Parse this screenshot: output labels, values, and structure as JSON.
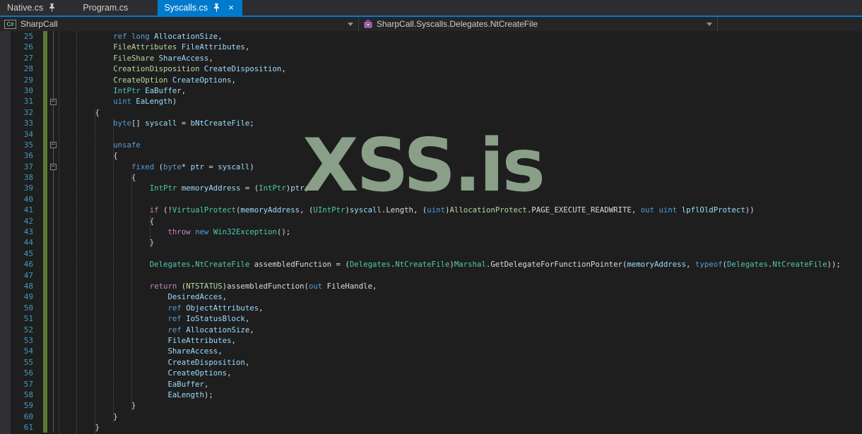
{
  "tabs": [
    {
      "label": "Native.cs",
      "pinned": true,
      "active": false
    },
    {
      "label": "Program.cs",
      "pinned": false,
      "active": false
    },
    {
      "label": "Syscalls.cs",
      "pinned": true,
      "active": true
    }
  ],
  "icons": {
    "close": "×",
    "fold_collapse": "−",
    "csharp_badge": "C#"
  },
  "navbar": {
    "project": "SharpCall",
    "member": "SharpCall.Syscalls.Delegates.NtCreateFile"
  },
  "watermark": {
    "text": "XSS.is",
    "color": "#93ab92"
  },
  "palette": {
    "accent": "#007acc",
    "editor_bg": "#1e1e1e",
    "tabstrip_bg": "#2d2d30",
    "navbar_bg": "#252526",
    "keyword": "#569cd6",
    "control_keyword": "#c586c0",
    "type": "#4ec9b0",
    "enum_type": "#b8d7a3",
    "identifier": "#9cdcfe",
    "plain_text": "#dcdcdc",
    "line_number": "#4399bd",
    "change_bar": "#5a7a32"
  },
  "editor": {
    "first_line": 25,
    "last_line": 61,
    "lines": [
      {
        "n": 25,
        "t": [
          [
            "i",
            "            "
          ],
          [
            "k",
            "ref"
          ],
          [
            "p",
            " "
          ],
          [
            "k",
            "long"
          ],
          [
            "p",
            " "
          ],
          [
            "v",
            "AllocationSize"
          ],
          [
            "p",
            ","
          ]
        ]
      },
      {
        "n": 26,
        "t": [
          [
            "i",
            "            "
          ],
          [
            "e",
            "FileAttributes"
          ],
          [
            "p",
            " "
          ],
          [
            "v",
            "FileAttributes"
          ],
          [
            "p",
            ","
          ]
        ]
      },
      {
        "n": 27,
        "t": [
          [
            "i",
            "            "
          ],
          [
            "e",
            "FileShare"
          ],
          [
            "p",
            " "
          ],
          [
            "v",
            "ShareAccess"
          ],
          [
            "p",
            ","
          ]
        ]
      },
      {
        "n": 28,
        "t": [
          [
            "i",
            "            "
          ],
          [
            "e",
            "CreationDisposition"
          ],
          [
            "p",
            " "
          ],
          [
            "v",
            "CreateDisposition"
          ],
          [
            "p",
            ","
          ]
        ]
      },
      {
        "n": 29,
        "t": [
          [
            "i",
            "            "
          ],
          [
            "e",
            "CreateOption"
          ],
          [
            "p",
            " "
          ],
          [
            "v",
            "CreateOptions"
          ],
          [
            "p",
            ","
          ]
        ]
      },
      {
        "n": 30,
        "t": [
          [
            "i",
            "            "
          ],
          [
            "t",
            "IntPtr"
          ],
          [
            "p",
            " "
          ],
          [
            "v",
            "EaBuffer"
          ],
          [
            "p",
            ","
          ]
        ]
      },
      {
        "n": 31,
        "fold": true,
        "t": [
          [
            "i",
            "            "
          ],
          [
            "k",
            "uint"
          ],
          [
            "p",
            " "
          ],
          [
            "v",
            "EaLength"
          ],
          [
            "p",
            ")"
          ]
        ]
      },
      {
        "n": 32,
        "t": [
          [
            "i",
            "        "
          ],
          [
            "p",
            "{"
          ]
        ]
      },
      {
        "n": 33,
        "t": [
          [
            "i",
            "            "
          ],
          [
            "k",
            "byte"
          ],
          [
            "p",
            "[] "
          ],
          [
            "v",
            "syscall"
          ],
          [
            "p",
            " = "
          ],
          [
            "v",
            "bNtCreateFile"
          ],
          [
            "p",
            ";"
          ]
        ]
      },
      {
        "n": 34,
        "t": []
      },
      {
        "n": 35,
        "fold": true,
        "t": [
          [
            "i",
            "            "
          ],
          [
            "k",
            "unsafe"
          ]
        ]
      },
      {
        "n": 36,
        "t": [
          [
            "i",
            "            "
          ],
          [
            "p",
            "{"
          ]
        ]
      },
      {
        "n": 37,
        "fold": true,
        "t": [
          [
            "i",
            "                "
          ],
          [
            "k",
            "fixed"
          ],
          [
            "p",
            " ("
          ],
          [
            "k",
            "byte"
          ],
          [
            "p",
            "* "
          ],
          [
            "v",
            "ptr"
          ],
          [
            "p",
            " = "
          ],
          [
            "v",
            "syscall"
          ],
          [
            "p",
            ")"
          ]
        ]
      },
      {
        "n": 38,
        "t": [
          [
            "i",
            "                "
          ],
          [
            "p",
            "{"
          ]
        ]
      },
      {
        "n": 39,
        "t": [
          [
            "i",
            "                    "
          ],
          [
            "t",
            "IntPtr"
          ],
          [
            "p",
            " "
          ],
          [
            "v",
            "memoryAddress"
          ],
          [
            "p",
            " = ("
          ],
          [
            "t",
            "IntPtr"
          ],
          [
            "p",
            ")"
          ],
          [
            "v",
            "ptr"
          ],
          [
            "p",
            ";"
          ]
        ]
      },
      {
        "n": 40,
        "t": []
      },
      {
        "n": 41,
        "t": [
          [
            "i",
            "                    "
          ],
          [
            "c",
            "if"
          ],
          [
            "p",
            " (!"
          ],
          [
            "t",
            "VirtualProtect"
          ],
          [
            "p",
            "("
          ],
          [
            "v",
            "memoryAddress"
          ],
          [
            "p",
            ", ("
          ],
          [
            "t",
            "UIntPtr"
          ],
          [
            "p",
            ")"
          ],
          [
            "v",
            "syscall"
          ],
          [
            "p",
            ".Length, ("
          ],
          [
            "k",
            "uint"
          ],
          [
            "p",
            ")"
          ],
          [
            "e",
            "AllocationProtect"
          ],
          [
            "p",
            ".PAGE_EXECUTE_READWRITE, "
          ],
          [
            "k",
            "out"
          ],
          [
            "p",
            " "
          ],
          [
            "k",
            "uint"
          ],
          [
            "p",
            " "
          ],
          [
            "v",
            "lpflOldProtect"
          ],
          [
            "p",
            "))"
          ]
        ]
      },
      {
        "n": 42,
        "t": [
          [
            "i",
            "                    "
          ],
          [
            "p",
            "{"
          ]
        ]
      },
      {
        "n": 43,
        "t": [
          [
            "i",
            "                        "
          ],
          [
            "c",
            "throw"
          ],
          [
            "p",
            " "
          ],
          [
            "k",
            "new"
          ],
          [
            "p",
            " "
          ],
          [
            "t",
            "Win32Exception"
          ],
          [
            "p",
            "();"
          ]
        ]
      },
      {
        "n": 44,
        "t": [
          [
            "i",
            "                    "
          ],
          [
            "p",
            "}"
          ]
        ]
      },
      {
        "n": 45,
        "t": []
      },
      {
        "n": 46,
        "t": [
          [
            "i",
            "                    "
          ],
          [
            "t",
            "Delegates"
          ],
          [
            "p",
            "."
          ],
          [
            "t",
            "NtCreateFile"
          ],
          [
            "p",
            " assembledFunction = ("
          ],
          [
            "t",
            "Delegates"
          ],
          [
            "p",
            "."
          ],
          [
            "t",
            "NtCreateFile"
          ],
          [
            "p",
            ")"
          ],
          [
            "t",
            "Marshal"
          ],
          [
            "p",
            ".GetDelegateForFunctionPointer("
          ],
          [
            "v",
            "memoryAddress"
          ],
          [
            "p",
            ", "
          ],
          [
            "k",
            "typeof"
          ],
          [
            "p",
            "("
          ],
          [
            "t",
            "Delegates"
          ],
          [
            "p",
            "."
          ],
          [
            "t",
            "NtCreateFile"
          ],
          [
            "p",
            "));"
          ]
        ]
      },
      {
        "n": 47,
        "t": []
      },
      {
        "n": 48,
        "t": [
          [
            "i",
            "                    "
          ],
          [
            "c",
            "return"
          ],
          [
            "p",
            " ("
          ],
          [
            "e",
            "NTSTATUS"
          ],
          [
            "p",
            ")assembledFunction("
          ],
          [
            "k",
            "out"
          ],
          [
            "p",
            " FileHandle,"
          ]
        ]
      },
      {
        "n": 49,
        "t": [
          [
            "i",
            "                        "
          ],
          [
            "v",
            "DesiredAcces"
          ],
          [
            "p",
            ","
          ]
        ]
      },
      {
        "n": 50,
        "t": [
          [
            "i",
            "                        "
          ],
          [
            "k",
            "ref"
          ],
          [
            "p",
            " "
          ],
          [
            "v",
            "ObjectAttributes"
          ],
          [
            "p",
            ","
          ]
        ]
      },
      {
        "n": 51,
        "t": [
          [
            "i",
            "                        "
          ],
          [
            "k",
            "ref"
          ],
          [
            "p",
            " "
          ],
          [
            "v",
            "IoStatusBlock"
          ],
          [
            "p",
            ","
          ]
        ]
      },
      {
        "n": 52,
        "t": [
          [
            "i",
            "                        "
          ],
          [
            "k",
            "ref"
          ],
          [
            "p",
            " "
          ],
          [
            "v",
            "AllocationSize"
          ],
          [
            "p",
            ","
          ]
        ]
      },
      {
        "n": 53,
        "t": [
          [
            "i",
            "                        "
          ],
          [
            "v",
            "FileAttributes"
          ],
          [
            "p",
            ","
          ]
        ]
      },
      {
        "n": 54,
        "t": [
          [
            "i",
            "                        "
          ],
          [
            "v",
            "ShareAccess"
          ],
          [
            "p",
            ","
          ]
        ]
      },
      {
        "n": 55,
        "t": [
          [
            "i",
            "                        "
          ],
          [
            "v",
            "CreateDisposition"
          ],
          [
            "p",
            ","
          ]
        ]
      },
      {
        "n": 56,
        "t": [
          [
            "i",
            "                        "
          ],
          [
            "v",
            "CreateOptions"
          ],
          [
            "p",
            ","
          ]
        ]
      },
      {
        "n": 57,
        "t": [
          [
            "i",
            "                        "
          ],
          [
            "v",
            "EaBuffer"
          ],
          [
            "p",
            ","
          ]
        ]
      },
      {
        "n": 58,
        "t": [
          [
            "i",
            "                        "
          ],
          [
            "v",
            "EaLength"
          ],
          [
            "p",
            ");"
          ]
        ]
      },
      {
        "n": 59,
        "t": [
          [
            "i",
            "                "
          ],
          [
            "p",
            "}"
          ]
        ]
      },
      {
        "n": 60,
        "t": [
          [
            "i",
            "            "
          ],
          [
            "p",
            "}"
          ]
        ]
      },
      {
        "n": 61,
        "t": [
          [
            "i",
            "        "
          ],
          [
            "p",
            "}"
          ]
        ]
      }
    ]
  }
}
